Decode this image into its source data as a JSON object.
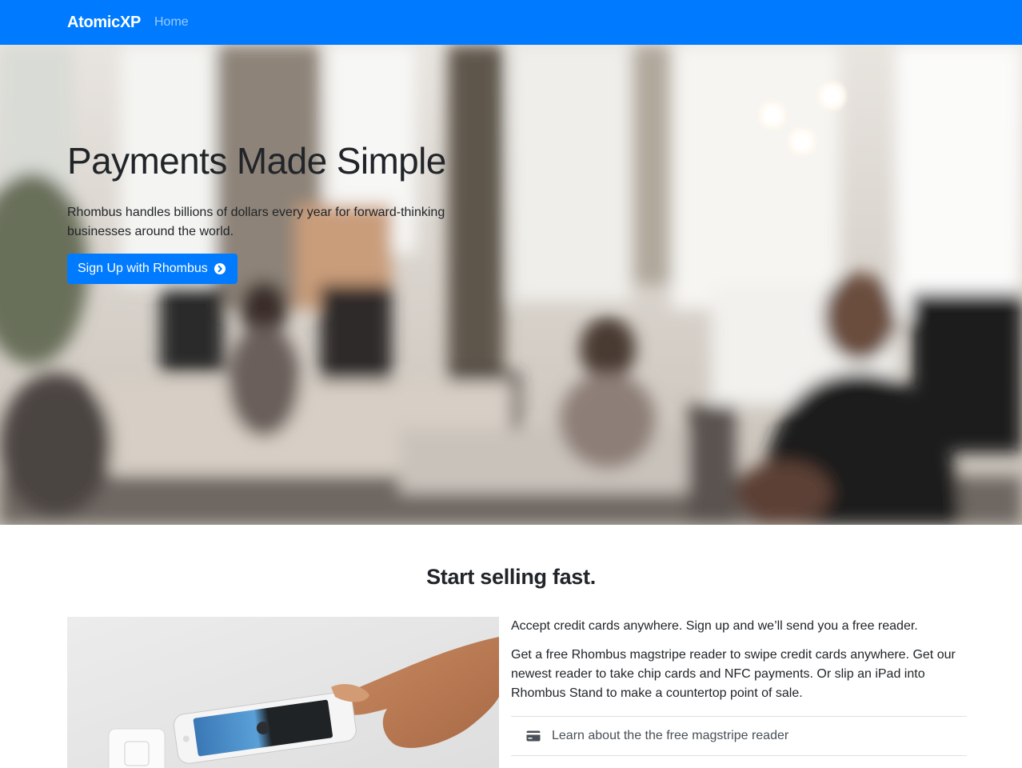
{
  "navbar": {
    "brand": "AtomicXP",
    "links": [
      {
        "label": "Home"
      }
    ],
    "background": "#007bff"
  },
  "hero": {
    "title": "Payments Made Simple",
    "lead": "Rhombus handles billions of dollars every year for forward-thinking businesses around the world.",
    "button_label": "Sign Up with Rhombus",
    "button_icon": "chevron-circle-right-icon",
    "background_image": "blurred office with people working at computers"
  },
  "section": {
    "title": "Start selling fast.",
    "image": "hand holding phone tapping card reader",
    "intro": "Accept credit cards anywhere. Sign up and we’ll send you a free reader.",
    "body": "Get a free Rhombus magstripe reader to swipe credit cards anywhere. Get our newest reader to take chip cards and NFC payments. Or slip an iPad into Rhombus Stand to make a countertop point of sale.",
    "list": [
      {
        "icon": "credit-card-icon",
        "label": "Learn about the the free magstripe reader"
      }
    ]
  },
  "colors": {
    "accent": "#007bff",
    "text": "#212529"
  }
}
